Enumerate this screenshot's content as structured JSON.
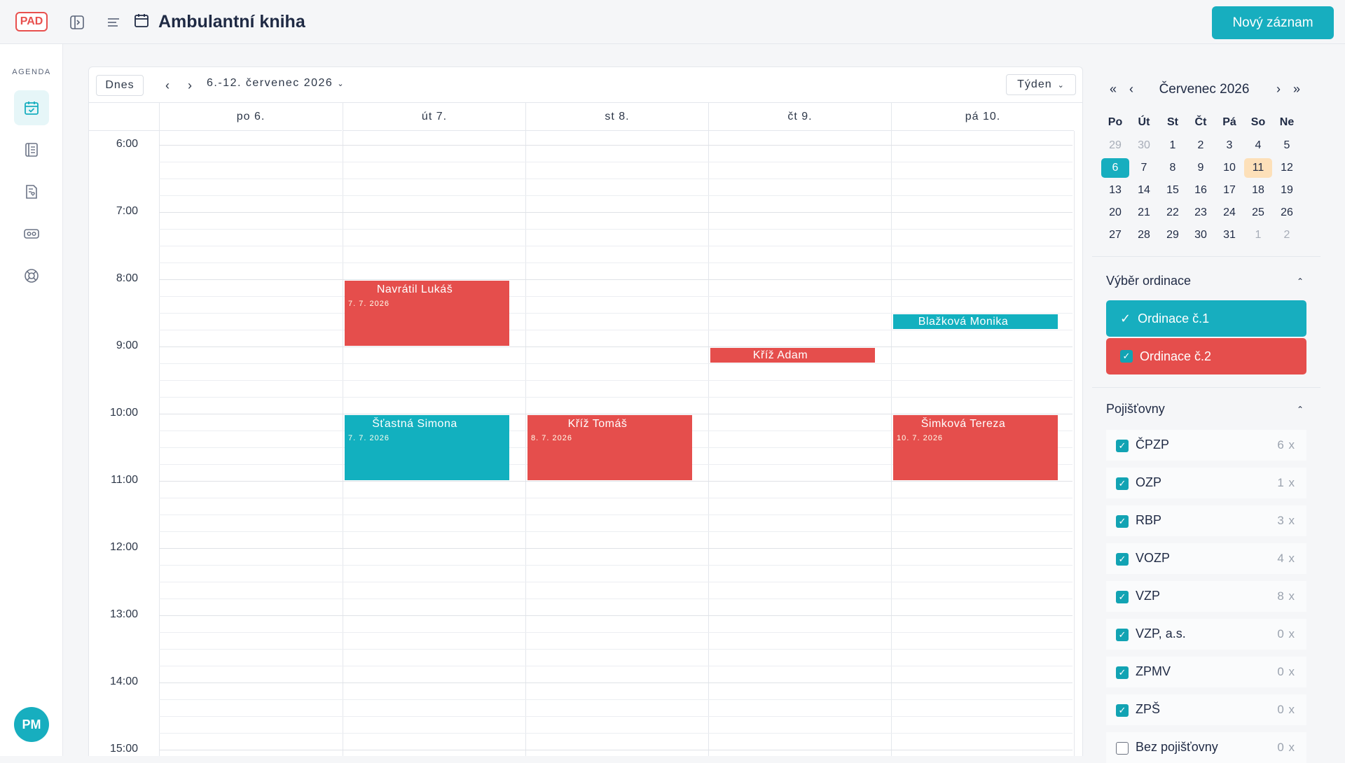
{
  "header": {
    "logo": "PAD",
    "title": "Ambulantní kniha",
    "new_button": "Nový záznam"
  },
  "sidebar": {
    "section_label": "AGENDA",
    "items": [
      "calendar-check-icon",
      "book-icon",
      "document-heart-icon",
      "id-card-icon",
      "lifebuoy-icon"
    ],
    "avatar": "PM"
  },
  "calendar": {
    "today_button": "Dnes",
    "prev": "‹",
    "next": "›",
    "range": "6.-12. červenec 2026",
    "view": "Týden",
    "days": [
      "po 6.",
      "út 7.",
      "st 8.",
      "čt 9.",
      "pá 10."
    ],
    "hours": [
      "6:00",
      "7:00",
      "8:00",
      "9:00",
      "10:00",
      "11:00",
      "12:00",
      "13:00",
      "14:00",
      "15:00"
    ],
    "events": [
      {
        "name": "Navrátil Lukáš",
        "date": "7. 7. 2026",
        "day": 1,
        "start": "8:00",
        "end": "9:00",
        "color": "#e54e4c"
      },
      {
        "name": "Blažková Monika",
        "date": "",
        "day": 4,
        "start": "8:30",
        "end": "8:45",
        "color": "#12b0bf"
      },
      {
        "name": "Kříž Adam",
        "date": "",
        "day": 3,
        "start": "9:00",
        "end": "9:15",
        "color": "#e54e4c"
      },
      {
        "name": "Šťastná Simona",
        "date": "7. 7. 2026",
        "day": 1,
        "start": "10:00",
        "end": "11:00",
        "color": "#12b0bf"
      },
      {
        "name": "Kříž Tomáš",
        "date": "8. 7. 2026",
        "day": 2,
        "start": "10:00",
        "end": "11:00",
        "color": "#e54e4c"
      },
      {
        "name": "Šimková Tereza",
        "date": "10. 7. 2026",
        "day": 4,
        "start": "10:00",
        "end": "11:00",
        "color": "#e54e4c"
      }
    ]
  },
  "mini_calendar": {
    "title": "Červenec 2026",
    "prev_year": "«",
    "prev_month": "‹",
    "next_month": "›",
    "next_year": "»",
    "weekdays": [
      "Po",
      "Út",
      "St",
      "Čt",
      "Pá",
      "So",
      "Ne"
    ],
    "weeks": [
      [
        "29",
        "30",
        "1",
        "2",
        "3",
        "4",
        "5"
      ],
      [
        "6",
        "7",
        "8",
        "9",
        "10",
        "11",
        "12"
      ],
      [
        "13",
        "14",
        "15",
        "16",
        "17",
        "18",
        "19"
      ],
      [
        "20",
        "21",
        "22",
        "23",
        "24",
        "25",
        "26"
      ],
      [
        "27",
        "28",
        "29",
        "30",
        "31",
        "1",
        "2"
      ]
    ],
    "selected": "6",
    "today": "11"
  },
  "ordinace": {
    "title": "Výběr ordinace",
    "items": [
      {
        "label": "Ordinace č.1",
        "color": "#17aebf"
      },
      {
        "label": "Ordinace č.2",
        "color": "#e54e4c"
      }
    ]
  },
  "pojistovny": {
    "title": "Pojišťovny",
    "items": [
      {
        "label": "ČPZP",
        "count": "6 x",
        "checked": true
      },
      {
        "label": "OZP",
        "count": "1 x",
        "checked": true
      },
      {
        "label": "RBP",
        "count": "3 x",
        "checked": true
      },
      {
        "label": "VOZP",
        "count": "4 x",
        "checked": true
      },
      {
        "label": "VZP",
        "count": "8 x",
        "checked": true
      },
      {
        "label": "VZP, a.s.",
        "count": "0 x",
        "checked": true
      },
      {
        "label": "ZPMV",
        "count": "0 x",
        "checked": true
      },
      {
        "label": "ZPŠ",
        "count": "0 x",
        "checked": true
      },
      {
        "label": "Bez pojišťovny",
        "count": "0 x",
        "checked": false
      }
    ]
  }
}
